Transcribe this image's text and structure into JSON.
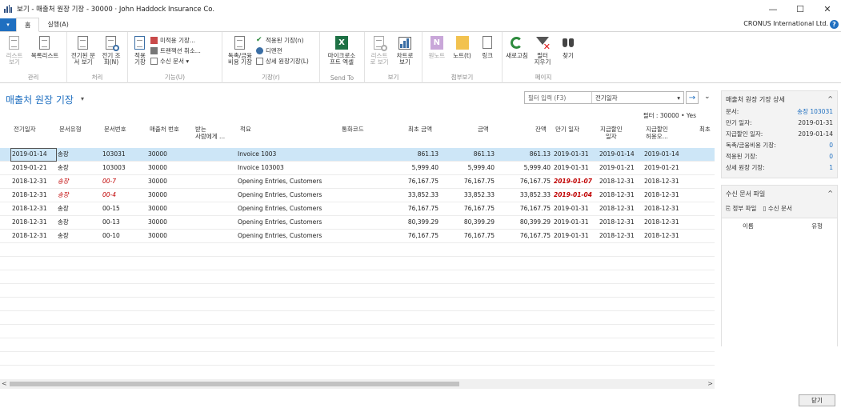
{
  "window": {
    "title": "보기 - 매출처 원장 기장 - 30000 · John Haddock Insurance Co.",
    "controls": [
      "—",
      "☐",
      "✕"
    ]
  },
  "ribbon_tabs": {
    "file_glyph": "▾",
    "tabs": [
      "홈",
      "실행(A)"
    ],
    "company": "CRONUS International Ltd.",
    "help": "?"
  },
  "ribbon": {
    "groups": [
      {
        "label": "관리",
        "buttons": [
          "리스트\n보기",
          "목록리스트"
        ]
      },
      {
        "label": "처리",
        "buttons": [
          "전기된 문\n서 보기",
          "전기 조\n회(N)"
        ]
      },
      {
        "label": "기능(U)",
        "buttons": [
          "적용\n기장"
        ],
        "small": [
          "미적용 기장...",
          "트랜잭션 취소...",
          "수신 문서 ▾"
        ]
      },
      {
        "label": "기장(r)",
        "buttons": [
          "독촉/금융\n비용 기장"
        ],
        "small": [
          "적용된 기장(n)",
          "디멘젼",
          "상세 원장기장(L)"
        ]
      },
      {
        "label": "Send To",
        "buttons": [
          "마이크로소\n프트 엑셀"
        ]
      },
      {
        "label": "보기",
        "buttons": [
          "리스트\n로 보기",
          "차트로\n보기"
        ]
      },
      {
        "label": "첨부보기",
        "buttons": [
          "원노트",
          "노트(t)",
          "링크"
        ]
      },
      {
        "label": "페이지",
        "buttons": [
          "새로고침",
          "필터\n지우기",
          "찾기"
        ]
      }
    ]
  },
  "page": {
    "title": "매출처 원장 기장",
    "title_caret": "▾",
    "filter_placeholder": "필터 입력 (F3)",
    "filter_field": "전기일자",
    "filter_field_caret": "▾",
    "filter_go": "→",
    "collapse": "⌄",
    "filter_status": "필터 : 30000 • Yes"
  },
  "table": {
    "columns": [
      "전기일자",
      "문서유형",
      "문서번호",
      "매출처 번호",
      "받는\n사람에게 ...",
      "적요",
      "통화코드",
      "최초 금액",
      "금액",
      "잔액",
      "만기 일자",
      "지급할인\n일자",
      "지급할인\n허용오...",
      "최초"
    ],
    "rows": [
      [
        "2019-01-14",
        "송장",
        "103031",
        "30000",
        "",
        "Invoice 1003",
        "",
        "861.13",
        "861.13",
        "861.13",
        "2019-01-31",
        "2019-01-14",
        "2019-01-14"
      ],
      [
        "2019-01-21",
        "송장",
        "103003",
        "30000",
        "",
        "Invoice 103003",
        "",
        "5,999.40",
        "5,999.40",
        "5,999.40",
        "2019-01-31",
        "2019-01-21",
        "2019-01-21"
      ],
      [
        "2018-12-31",
        "송장",
        "00-7",
        "30000",
        "",
        "Opening Entries, Customers",
        "",
        "76,167.75",
        "76,167.75",
        "76,167.75",
        "2019-01-07",
        "2018-12-31",
        "2018-12-31"
      ],
      [
        "2018-12-31",
        "송장",
        "00-4",
        "30000",
        "",
        "Opening Entries, Customers",
        "",
        "33,852.33",
        "33,852.33",
        "33,852.33",
        "2019-01-04",
        "2018-12-31",
        "2018-12-31"
      ],
      [
        "2018-12-31",
        "송장",
        "00-15",
        "30000",
        "",
        "Opening Entries, Customers",
        "",
        "76,167.75",
        "76,167.75",
        "76,167.75",
        "2019-01-31",
        "2018-12-31",
        "2018-12-31"
      ],
      [
        "2018-12-31",
        "송장",
        "00-13",
        "30000",
        "",
        "Opening Entries, Customers",
        "",
        "80,399.29",
        "80,399.29",
        "80,399.29",
        "2019-01-31",
        "2018-12-31",
        "2018-12-31"
      ],
      [
        "2018-12-31",
        "송장",
        "00-10",
        "30000",
        "",
        "Opening Entries, Customers",
        "",
        "76,167.75",
        "76,167.75",
        "76,167.75",
        "2019-01-31",
        "2018-12-31",
        "2018-12-31"
      ]
    ],
    "overdue_rows": [
      2,
      3
    ]
  },
  "details_panel": {
    "title": "매출처 원장 기장 상세",
    "caret": "^",
    "rows": [
      {
        "label": "문서:",
        "value": "송장 103031"
      },
      {
        "label": "만기 일자:",
        "value": "2019-01-31"
      },
      {
        "label": "지급할인 일자:",
        "value": "2019-01-14"
      },
      {
        "label": "독촉/금융비용 기장:",
        "value": "0"
      },
      {
        "label": "적용된 기장:",
        "value": "0"
      },
      {
        "label": "상세 원장 기장:",
        "value": "1"
      }
    ]
  },
  "files_panel": {
    "title": "수신 문서 파일",
    "caret": "^",
    "actions": [
      "정부 파일",
      "수신 문서"
    ],
    "columns": [
      "이름",
      "유형"
    ]
  },
  "scroll": {
    "left": "<",
    "right": ">"
  },
  "close_label": "닫기"
}
